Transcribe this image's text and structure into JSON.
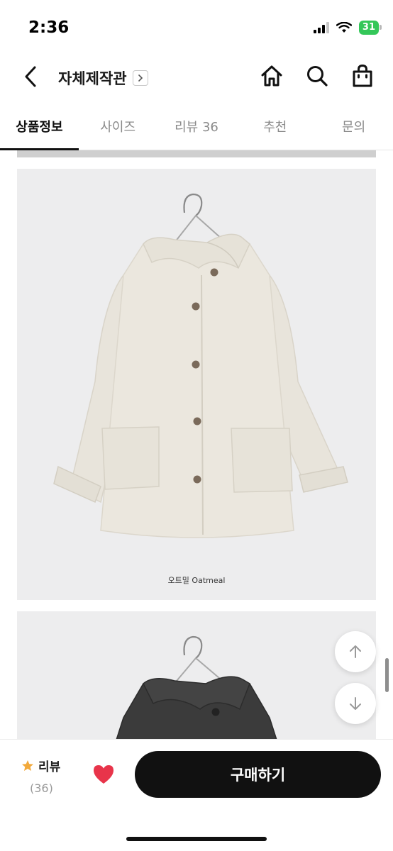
{
  "status": {
    "time": "2:36",
    "battery": "31"
  },
  "nav": {
    "title": "자체제작관",
    "icons": [
      "chevron-left-icon",
      "chevron-right-icon",
      "home-icon",
      "search-icon",
      "shopping-bag-icon"
    ]
  },
  "tabs": [
    {
      "label": "상품정보",
      "active": true
    },
    {
      "label": "사이즈",
      "active": false
    },
    {
      "label": "리뷰 36",
      "active": false
    },
    {
      "label": "추천",
      "active": false
    },
    {
      "label": "문의",
      "active": false
    }
  ],
  "product": {
    "caption": "오트밀 Oatmeal"
  },
  "bottom": {
    "review_label": "리뷰",
    "review_count": "(36)",
    "buy_label": "구매하기"
  },
  "colors": {
    "accent": "#111111",
    "star": "#f2a93b",
    "heart": "#e8344a",
    "coat_light": "#ebe7de",
    "coat_dark": "#3b3b3b"
  }
}
